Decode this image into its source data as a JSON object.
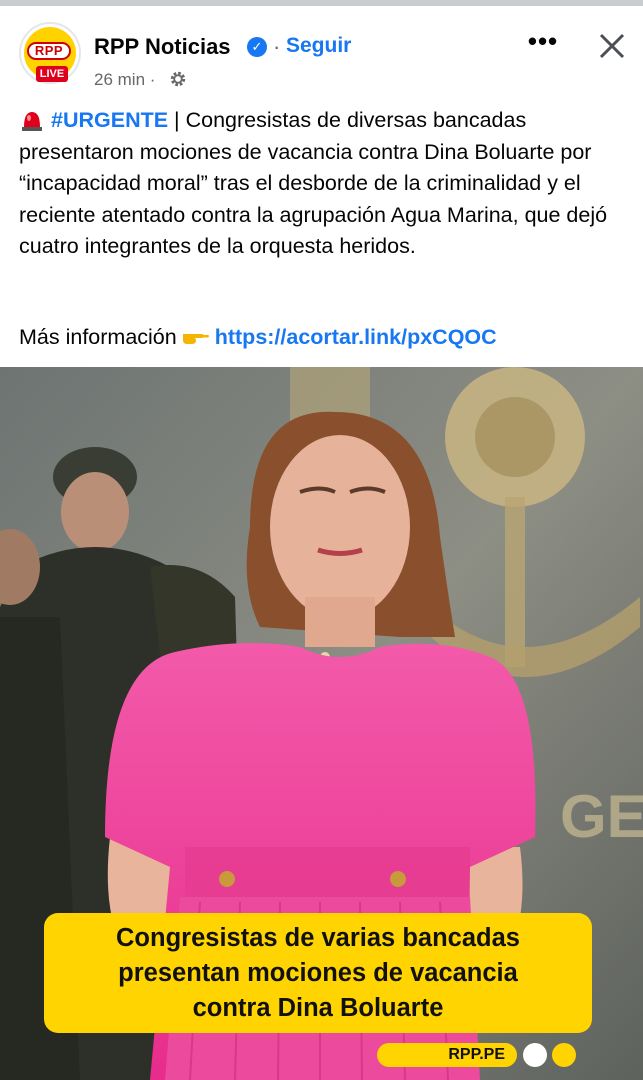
{
  "header": {
    "page_name": "RPP Noticias",
    "verified_icon": "verified-badge-icon",
    "separator": "·",
    "follow_label": "Seguir",
    "time": "26 min ·",
    "audience_icon": "gear-icon",
    "more_icon": "more-options-icon",
    "more_label": "•••",
    "close_icon": "close-icon",
    "avatar": {
      "logo_text": "RPP",
      "live_text": "LIVE"
    }
  },
  "post": {
    "siren_icon": "siren-icon",
    "hashtag": "#URGENTE",
    "body": " | Congresistas de diversas bancadas presentaron mociones de vacancia contra Dina Boluarte por “incapacidad moral” tras el desborde de la criminalidad y el reciente atentado contra la agrupación Agua Marina, que dejó cuatro integrantes de la orquesta heridos.",
    "more_info_label": "Más información",
    "pointer_icon": "pointing-hand-icon",
    "link": "https://acortar.link/pxCQOC"
  },
  "image": {
    "caption_lines": [
      "Congresistas de varias bancadas",
      "presentan mociones de vacancia",
      "contra Dina Boluarte"
    ],
    "brand": "RPP.PE"
  },
  "colors": {
    "accent": "#1877f2",
    "caption_bg": "#ffd400",
    "dress": "#f0409a"
  }
}
